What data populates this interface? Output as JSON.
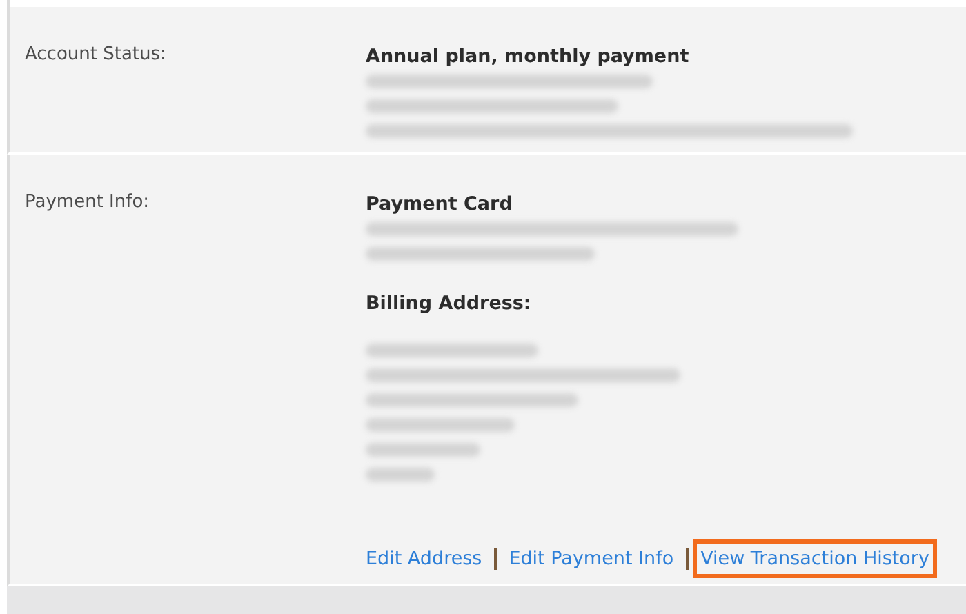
{
  "sections": [
    {
      "label": "Account Status:",
      "blocks": [
        {
          "heading": "Annual plan, monthly payment"
        }
      ]
    },
    {
      "label": "Payment Info:",
      "blocks": [
        {
          "heading": "Payment Card"
        },
        {
          "heading": "Billing Address:"
        }
      ],
      "links": [
        {
          "text": "Edit Address",
          "highlighted": false
        },
        {
          "text": "Edit Payment Info",
          "highlighted": false
        },
        {
          "text": "View Transaction History",
          "highlighted": true
        }
      ]
    }
  ]
}
